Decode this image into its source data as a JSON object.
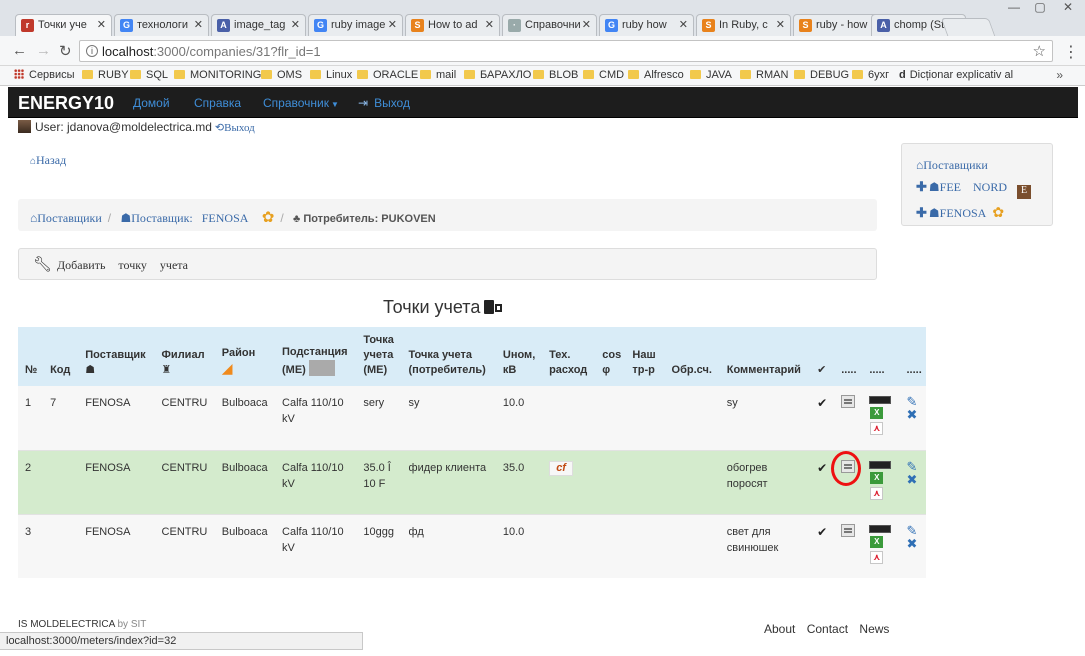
{
  "browser": {
    "tabs": [
      {
        "title": "Точки уче",
        "icon": "rails-icon"
      },
      {
        "title": "технологи",
        "icon": "google-icon"
      },
      {
        "title": "image_tag",
        "icon": "apidock-icon"
      },
      {
        "title": "ruby image",
        "icon": "google-icon"
      },
      {
        "title": "How to ad",
        "icon": "stackoverflow-icon"
      },
      {
        "title": "Справочни",
        "icon": "page-icon"
      },
      {
        "title": "ruby how",
        "icon": "google-icon"
      },
      {
        "title": "In Ruby, c",
        "icon": "stackoverflow-icon"
      },
      {
        "title": "ruby - how",
        "icon": "stackoverflow-icon"
      },
      {
        "title": "chomp (Str",
        "icon": "apidock-icon"
      }
    ],
    "address": {
      "host": "localhost",
      "path": ":3000/companies/31?flr_id=1"
    },
    "bookmarks": [
      "Сервисы",
      "RUBY",
      "SQL",
      "MONITORING",
      "OMS",
      "Linux",
      "ORACLE",
      "mail",
      "БАРАХЛО",
      "BLOB",
      "CMD",
      "Alfresco",
      "JAVA",
      "RMAN",
      "DEBUG",
      "6ухг",
      "Dicționar explicativ al"
    ],
    "more": "»",
    "status_url": "localhost:3000/meters/index?id=32"
  },
  "app": {
    "brand": "ENERGY10",
    "nav": {
      "home": "Домой",
      "help": "Справка",
      "reference": "Справочник",
      "exit": "Выход"
    },
    "user": {
      "label": "User: jdanova@moldelectrica.md",
      "logout": "Выход"
    },
    "back": "Назад",
    "breadcrumb": {
      "suppliers": "Поставщики",
      "supplier_prefix": "Поставщик:",
      "supplier": "FENOSA",
      "consumer_prefix": "Потребитель:",
      "consumer": "PUKOVEN"
    },
    "toolbar_words": [
      "Добавить",
      "точку",
      "учета"
    ],
    "side": {
      "title": "Поставщики",
      "items": [
        {
          "a": "FEE",
          "b": "NORD"
        },
        {
          "a": "FENOSA",
          "b": ""
        }
      ]
    },
    "title": "Точки учета"
  },
  "table": {
    "headers": [
      "№",
      "Код",
      "Поставщик",
      "Филиал",
      "Район",
      "Подстанция (ME)",
      "Точка учета (ME)",
      "Точка учета (потребитель)",
      "Uном, кВ",
      "Тех. расход",
      "cos φ",
      "Наш тр-р",
      "Обр.сч.",
      "Комментарий",
      "✔",
      ".....",
      ".....",
      "....."
    ],
    "rows": [
      {
        "n": "1",
        "code": "7",
        "supplier": "FENOSA",
        "branch": "CENTRU",
        "district": "Bulboaca",
        "substation": "Calfa 110/10 kV",
        "point_me": "sery",
        "point_consumer": "sy",
        "u": "10.0",
        "tech": "",
        "comment": "sy"
      },
      {
        "n": "2",
        "code": "",
        "supplier": "FENOSA",
        "branch": "CENTRU",
        "district": "Bulboaca",
        "substation": "Calfa 110/10 kV",
        "point_me": "35.0 Î 10 F",
        "point_consumer": "фидер клиента",
        "u": "35.0",
        "tech": "cf",
        "comment": "обогрев поросят"
      },
      {
        "n": "3",
        "code": "",
        "supplier": "FENOSA",
        "branch": "CENTRU",
        "district": "Bulboaca",
        "substation": "Calfa 110/10 kV",
        "point_me": "10ggg",
        "point_consumer": "фд",
        "u": "10.0",
        "tech": "",
        "comment": "свет для свинюшек"
      }
    ]
  },
  "footer": {
    "org": "IS MOLDELECTRICA",
    "by": "by SIT",
    "links": [
      "About",
      "Contact",
      "News"
    ]
  },
  "colors": {
    "header_bg": "#d9ecf7",
    "highlight_row": "#d4ebcd",
    "link": "#3a6aa8",
    "annotation_circle": "#ee1111"
  }
}
